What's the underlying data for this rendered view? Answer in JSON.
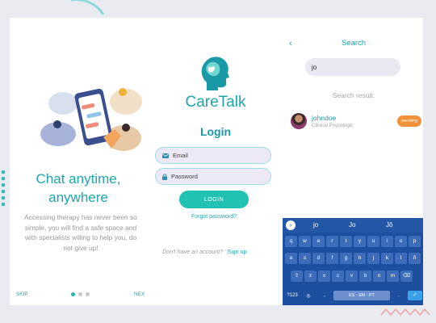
{
  "onboarding": {
    "title_line1": "Chat anytime,",
    "title_line2": "anywhere",
    "description": "Accessing therapy has never been so simple, you will find a safe space and with specialists willing to help you, do not give up!",
    "skip_label": "SKIP",
    "next_label": "NEX",
    "page_count": 3,
    "active_page": 1
  },
  "login": {
    "brand": "CareTalk",
    "title": "Login",
    "email_placeholder": "Email",
    "password_placeholder": "Password",
    "login_label": "LOGIN",
    "forgot_label": "Forgot password?",
    "no_account_text": "Don't have an account?",
    "signup_label": "Sign up"
  },
  "search": {
    "title": "Search",
    "back_icon": "chevron-left-icon",
    "query": "jo",
    "results_label": "Search result:",
    "results": [
      {
        "username": "johndoe",
        "role": "Clinical Psycologic",
        "status": "pending"
      }
    ]
  },
  "keyboard": {
    "suggestions": [
      "jo",
      "Jo",
      "Jô"
    ],
    "row1": [
      "q",
      "w",
      "e",
      "r",
      "t",
      "y",
      "u",
      "i",
      "o",
      "p"
    ],
    "row2": [
      "a",
      "s",
      "d",
      "f",
      "g",
      "h",
      "j",
      "k",
      "l",
      "ñ"
    ],
    "row3": [
      "⇧",
      "z",
      "x",
      "c",
      "v",
      "b",
      "n",
      "m",
      "⌫"
    ],
    "symbols_key": "?123",
    "space_label": "ES · EN · PT"
  },
  "colors": {
    "primary": "#1ea5ae",
    "accent": "#22c2b2",
    "badge": "#f0923a",
    "keyboard": "#1d4f9e"
  }
}
